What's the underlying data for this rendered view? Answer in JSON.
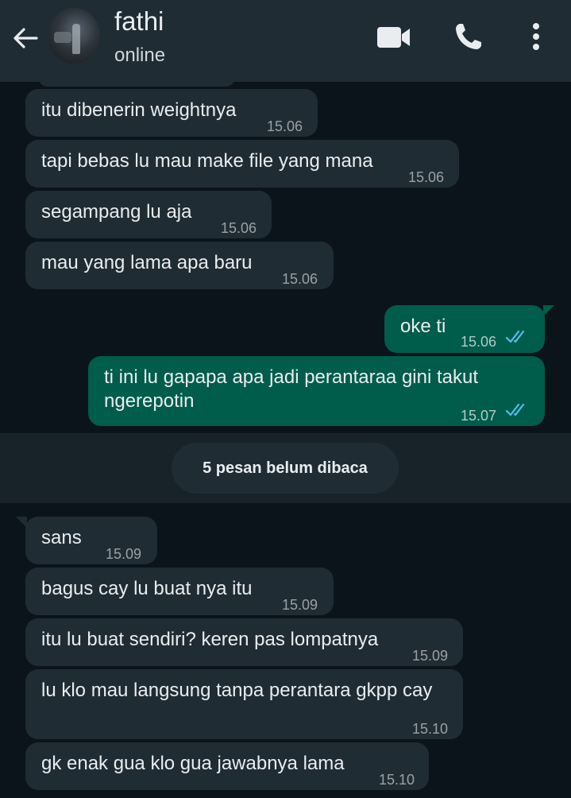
{
  "header": {
    "contact_name": "fathi",
    "status": "online",
    "icons": [
      "back-arrow-icon",
      "avatar",
      "video-call-icon",
      "voice-call-icon",
      "more-options-icon"
    ]
  },
  "messages": [
    {
      "direction": "in",
      "text": "itu dibenerin weightnya",
      "time": "15.06"
    },
    {
      "direction": "in",
      "text": "tapi bebas lu mau make file yang mana",
      "time": "15.06"
    },
    {
      "direction": "in",
      "text": "segampang lu aja",
      "time": "15.06"
    },
    {
      "direction": "in",
      "text": "mau yang lama apa baru",
      "time": "15.06"
    },
    {
      "direction": "out",
      "text": "oke ti",
      "time": "15.06",
      "read": true
    },
    {
      "direction": "out",
      "text": "ti ini lu gapapa apa jadi perantaraa gini takut ngerepotin",
      "time": "15.07",
      "read": true
    },
    {
      "direction": "in",
      "text": "sans",
      "time": "15.09"
    },
    {
      "direction": "in",
      "text": "bagus cay lu buat nya itu",
      "time": "15.09"
    },
    {
      "direction": "in",
      "text": "itu lu buat sendiri? keren pas lompatnya",
      "time": "15.09"
    },
    {
      "direction": "in",
      "text": "lu klo mau langsung tanpa perantara gkpp cay",
      "time": "15.10"
    },
    {
      "direction": "in",
      "text": "gk enak gua klo gua jawabnya lama",
      "time": "15.10"
    }
  ],
  "unread_banner": "5 pesan belum dibaca",
  "colors": {
    "background": "#0b141a",
    "header": "#1f2c34",
    "incoming_bubble": "#202c33",
    "outgoing_bubble": "#005c4b",
    "read_ticks": "#53bdeb"
  }
}
